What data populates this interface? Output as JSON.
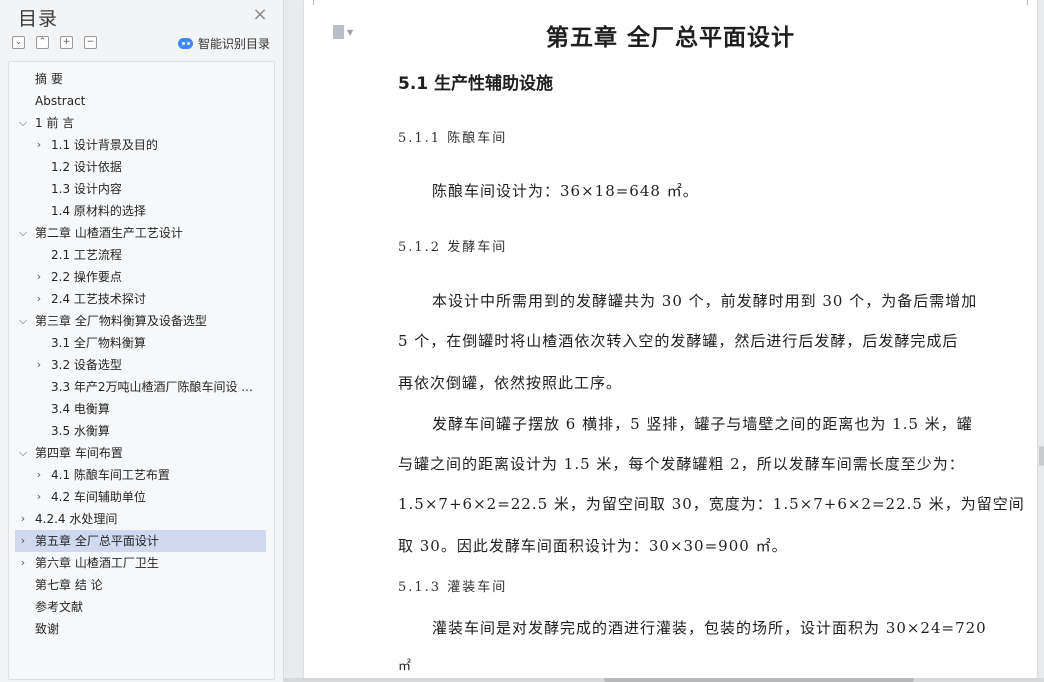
{
  "sidebar": {
    "title": "目录",
    "close_symbol": "×",
    "tools": [
      {
        "icon": "collapse-all-icon",
        "symbol": "⌄"
      },
      {
        "icon": "expand-all-icon",
        "symbol": "⌃"
      },
      {
        "icon": "add-heading-icon",
        "symbol": "+"
      },
      {
        "icon": "remove-heading-icon",
        "symbol": "−"
      }
    ],
    "smart_label": "智能识别目录",
    "items": [
      {
        "label": "摘  要",
        "level": 0,
        "arrow": ""
      },
      {
        "label": "Abstract",
        "level": 0,
        "arrow": ""
      },
      {
        "label": "1 前  言",
        "level": 0,
        "arrow": "expanded"
      },
      {
        "label": "1.1 设计背景及目的",
        "level": 1,
        "arrow": "collapsed"
      },
      {
        "label": "1.2 设计依据",
        "level": 1,
        "arrow": ""
      },
      {
        "label": "1.3 设计内容",
        "level": 1,
        "arrow": ""
      },
      {
        "label": "1.4 原材料的选择",
        "level": 1,
        "arrow": ""
      },
      {
        "label": "第二章  山楂酒生产工艺设计",
        "level": 0,
        "arrow": "expanded"
      },
      {
        "label": "2.1 工艺流程",
        "level": 1,
        "arrow": ""
      },
      {
        "label": "2.2 操作要点",
        "level": 1,
        "arrow": "collapsed"
      },
      {
        "label": "2.4 工艺技术探讨",
        "level": 1,
        "arrow": "collapsed"
      },
      {
        "label": "第三章  全厂物料衡算及设备选型",
        "level": 0,
        "arrow": "expanded"
      },
      {
        "label": "3.1 全厂物料衡算",
        "level": 1,
        "arrow": ""
      },
      {
        "label": "3.2 设备选型",
        "level": 1,
        "arrow": "collapsed"
      },
      {
        "label": "3.3 年产2万吨山楂酒厂陈酿车间设 ...",
        "level": 1,
        "arrow": ""
      },
      {
        "label": "3.4 电衡算",
        "level": 1,
        "arrow": ""
      },
      {
        "label": "3.5 水衡算",
        "level": 1,
        "arrow": ""
      },
      {
        "label": "第四章   车间布置",
        "level": 0,
        "arrow": "expanded"
      },
      {
        "label": "4.1 陈酿车间工艺布置",
        "level": 1,
        "arrow": "collapsed"
      },
      {
        "label": "4.2   车间辅助单位",
        "level": 1,
        "arrow": "collapsed"
      },
      {
        "label": "4.2.4 水处理间",
        "level": 0,
        "arrow": "collapsed"
      },
      {
        "label": "第五章  全厂总平面设计",
        "level": 0,
        "arrow": "collapsed",
        "active": true
      },
      {
        "label": "第六章   山楂酒工厂卫生",
        "level": 0,
        "arrow": "collapsed"
      },
      {
        "label": "第七章    结  论",
        "level": 0,
        "arrow": ""
      },
      {
        "label": "参考文献",
        "level": 0,
        "arrow": ""
      },
      {
        "label": "致谢",
        "level": 0,
        "arrow": ""
      }
    ]
  },
  "document": {
    "chapter_title": "第五章  全厂总平面设计",
    "section_title": "5.1 生产性辅助设施",
    "subsection_1": "5.1.1 陈酿车间",
    "para_1": "陈酿车间设计为：36×18=648 ㎡。",
    "subsection_2": "5.1.2 发酵车间",
    "para_2_l1": "本设计中所需用到的发酵罐共为 30 个，前发酵时用到 30 个，为备后需增加",
    "para_2_l2": "5 个，在倒罐时将山楂酒依次转入空的发酵罐，然后进行后发酵，后发酵完成后",
    "para_2_l3": "再依次倒罐，依然按照此工序。",
    "para_3_l1": "发酵车间罐子摆放 6 横排，5 竖排，罐子与墙壁之间的距离也为 1.5 米，罐",
    "para_3_l2": "与罐之间的距离设计为 1.5 米，每个发酵罐粗 2，所以发酵车间需长度至少为：",
    "para_3_l3": "1.5×7+6×2=22.5 米，为留空间取 30，宽度为：1.5×7+6×2=22.5 米，为留空间",
    "para_3_l4": "取 30。因此发酵车间面积设计为：30×30=900 ㎡。",
    "subsection_3": "5.1.3 灌装车间",
    "para_4_l1": "灌装车间是对发酵完成的酒进行灌装，包装的场所，设计面积为 30×24=720",
    "para_4_l2": "㎡"
  }
}
